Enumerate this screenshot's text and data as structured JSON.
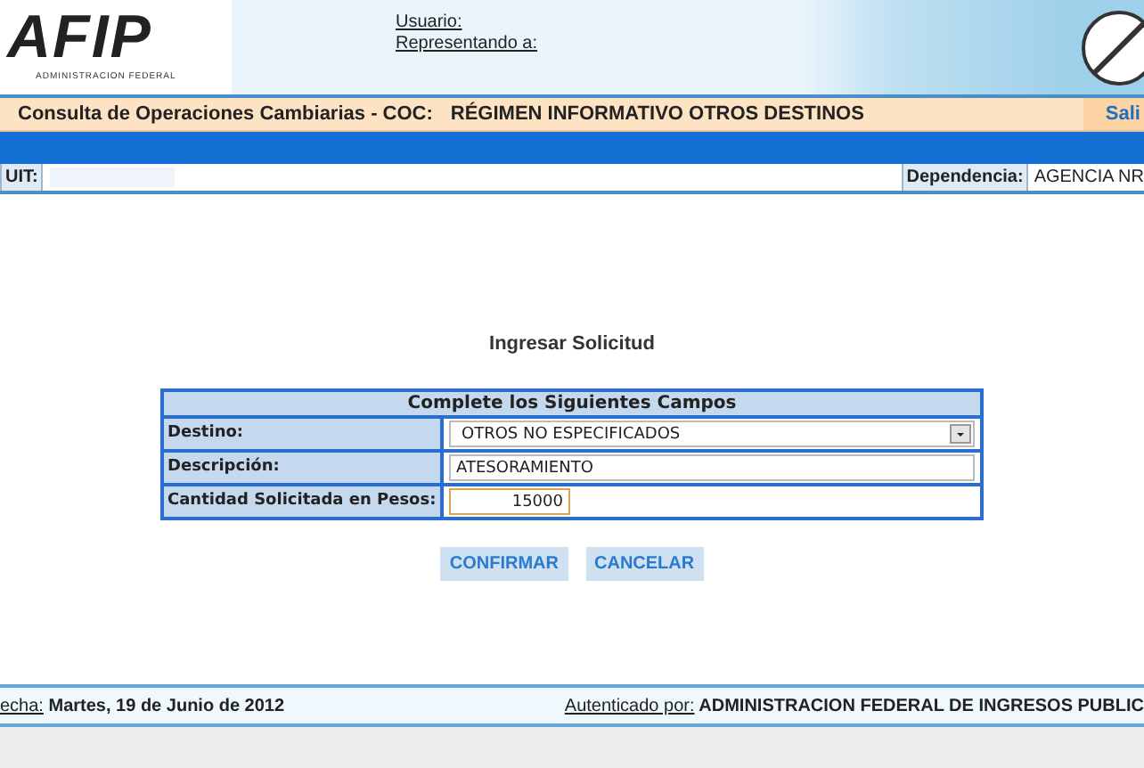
{
  "header": {
    "logo": "AFIP",
    "logo_caption": "ADMINISTRACION FEDERAL",
    "user_label": "Usuario:",
    "representing_label": "Representando a:"
  },
  "title_bar": {
    "title": "Consulta de Operaciones Cambiarias - COC:",
    "subtitle": "RÉGIMEN INFORMATIVO OTROS DESTINOS",
    "exit_link": "Sali"
  },
  "info_row": {
    "cuit_label": "UIT:",
    "dependencia_label": "Dependencia:",
    "dependencia_value": "AGENCIA NR"
  },
  "form": {
    "heading": "Ingresar Solicitud",
    "table_title": "Complete los Siguientes Campos",
    "fields": [
      {
        "kind": "select",
        "label": "Destino:",
        "value": "OTROS NO ESPECIFICADOS",
        "focused": false
      },
      {
        "kind": "text",
        "label": "Descripción:",
        "value": "ATESORAMIENTO",
        "focused": false
      },
      {
        "kind": "amount",
        "label": "Cantidad Solicitada en Pesos:",
        "value": "15000",
        "focused": true
      }
    ],
    "buttons": [
      "CONFIRMAR",
      "CANCELAR"
    ]
  },
  "footer": {
    "date_label": "echa:",
    "date_value": "Martes, 19 de Junio de 2012",
    "auth_label": "Autenticado por:",
    "auth_value": "ADMINISTRACION FEDERAL DE INGRESOS PUBLIC"
  }
}
